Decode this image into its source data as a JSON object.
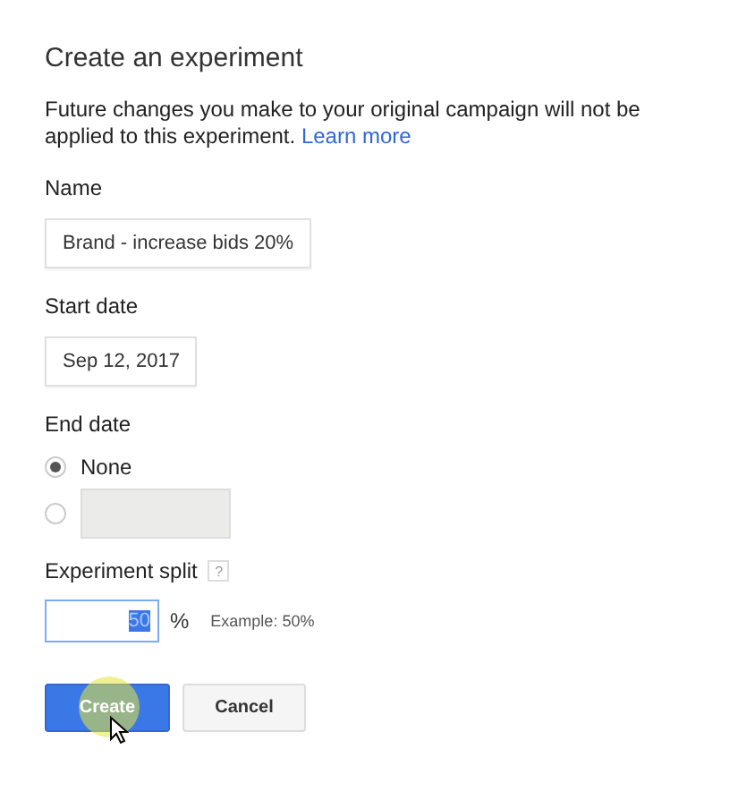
{
  "title": "Create an experiment",
  "description": {
    "text": "Future changes you make to your original campaign will not be applied to this experiment.",
    "link": "Learn more"
  },
  "name_field": {
    "label": "Name",
    "value": "Brand - increase bids 20%"
  },
  "start_date": {
    "label": "Start date",
    "value": "Sep 12, 2017"
  },
  "end_date": {
    "label": "End date",
    "options": [
      {
        "kind": "label",
        "label": "None",
        "selected": true
      },
      {
        "kind": "date",
        "disabled": true,
        "selected": false
      }
    ]
  },
  "split": {
    "label": "Experiment split",
    "help": "?",
    "value": "50",
    "focused": true,
    "value_selected": true,
    "unit": "%",
    "hint": "Example: 50%"
  },
  "buttons": [
    {
      "kind": "primary",
      "label": "Create"
    },
    {
      "kind": "secondary",
      "label": "Cancel"
    }
  ]
}
